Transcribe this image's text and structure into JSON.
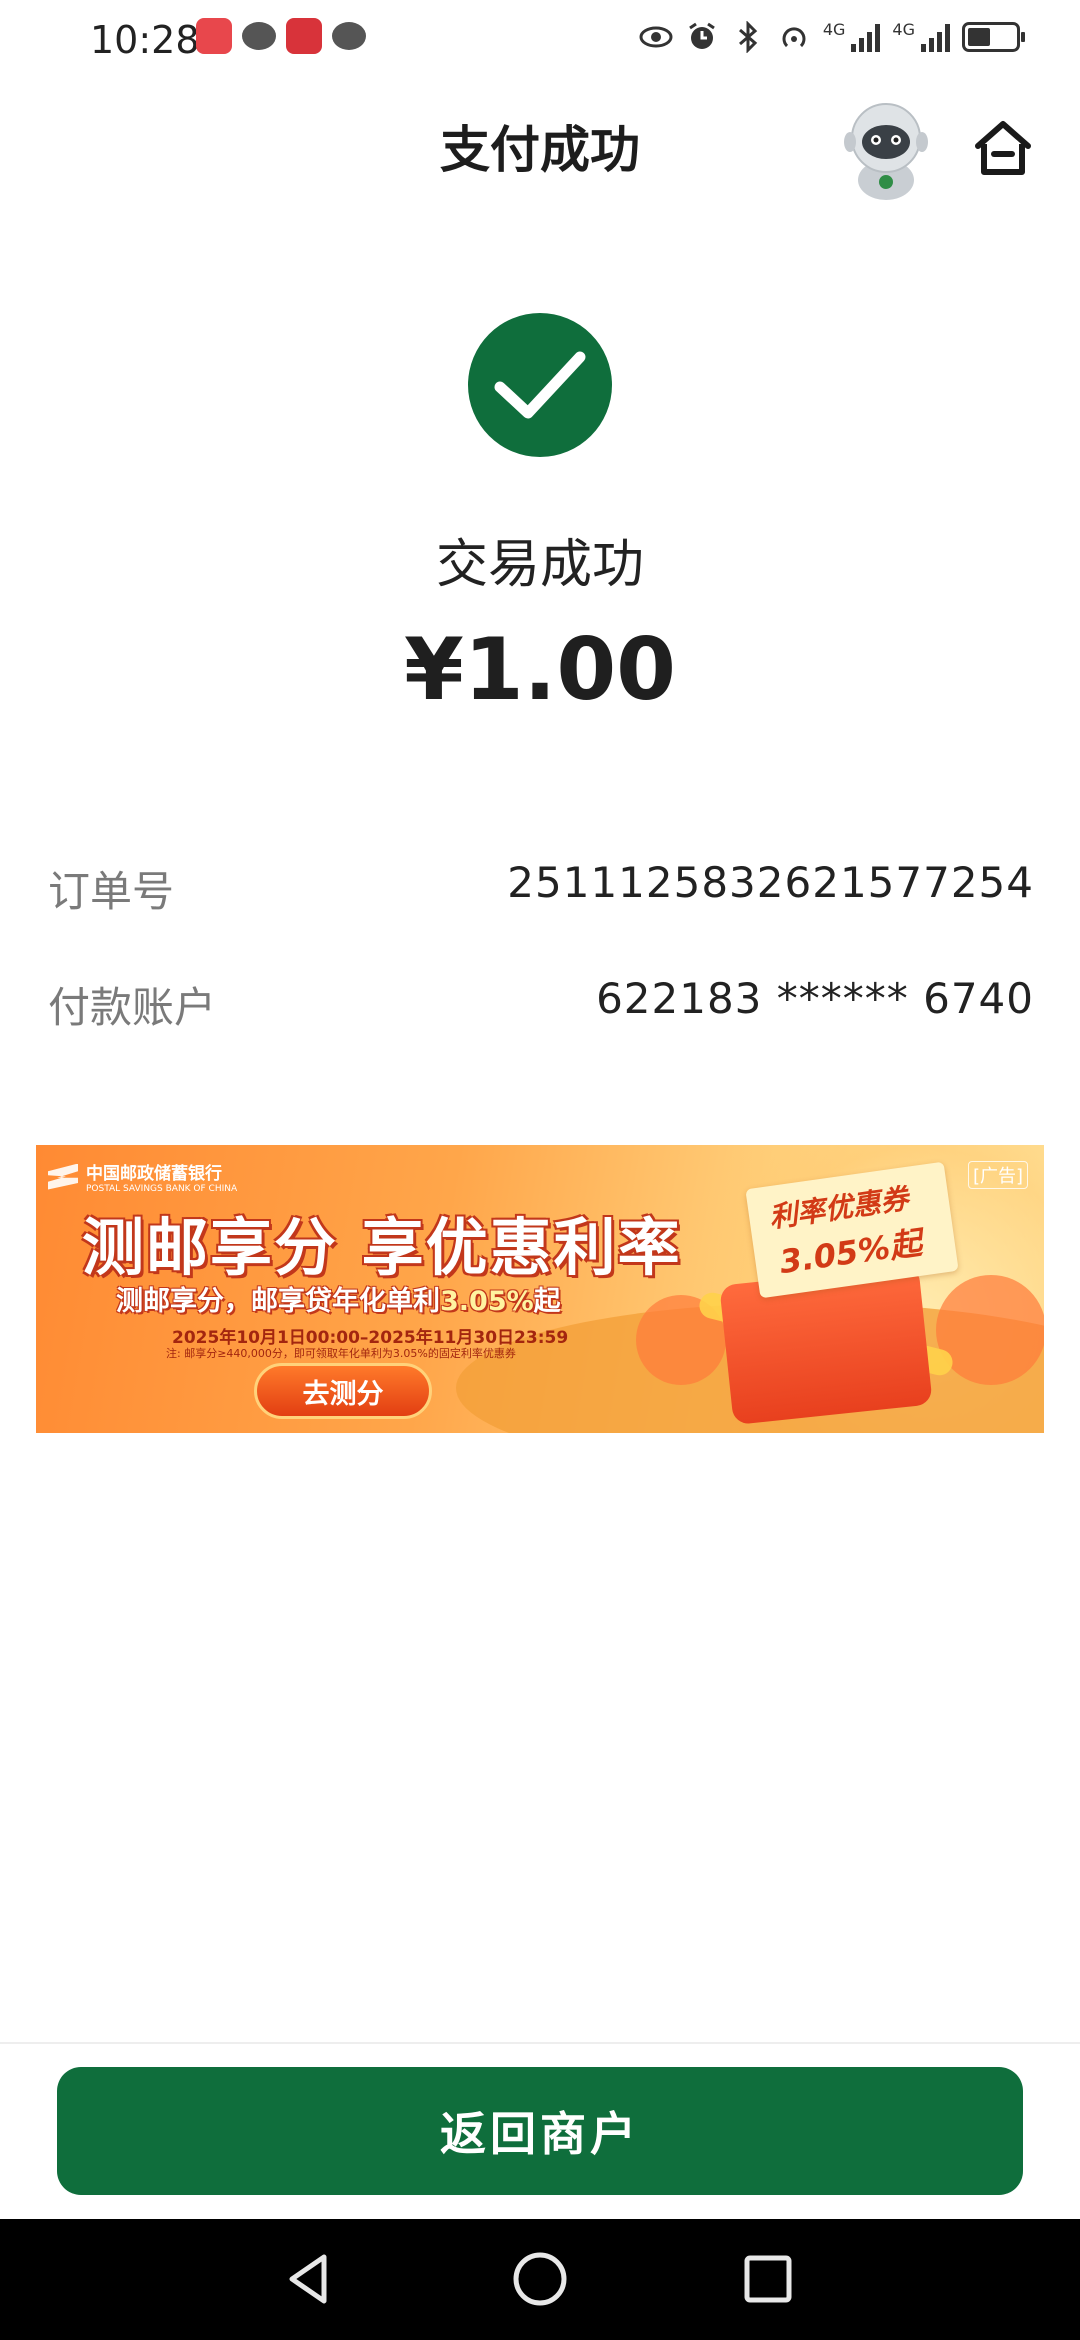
{
  "status_bar": {
    "time": "10:28",
    "net_1": "4G",
    "net_2": "4G"
  },
  "header": {
    "title": "支付成功",
    "icons": [
      "robot-assistant-icon",
      "home-icon"
    ]
  },
  "result": {
    "status_text": "交易成功",
    "amount": "¥1.00"
  },
  "details": {
    "order_label": "订单号",
    "order_value": "2511125832621577254",
    "account_label": "付款账户",
    "account_value": "622183 ****** 6740"
  },
  "banner": {
    "bank_name": "中国邮政储蓄银行",
    "bank_name_en": "POSTAL SAVINGS BANK OF CHINA",
    "ad_tag": "[广告]",
    "headline": "测邮享分 享优惠利率",
    "sub_prefix": "测邮享分，邮享贷年化单利",
    "sub_rate": "3.05%",
    "sub_suffix": "起",
    "date_range": "2025年10月1日00:00–2025年11月30日23:59",
    "note": "注: 邮享分≥440,000分，即可领取年化单利为3.05%的固定利率优惠券",
    "cta": "去测分",
    "coupon_title": "利率优惠券",
    "coupon_rate": "3.05%起"
  },
  "footer": {
    "return_button": "返回商户"
  },
  "colors": {
    "brand_green": "#0f6e3c",
    "banner_orange": "#ff8a33"
  }
}
